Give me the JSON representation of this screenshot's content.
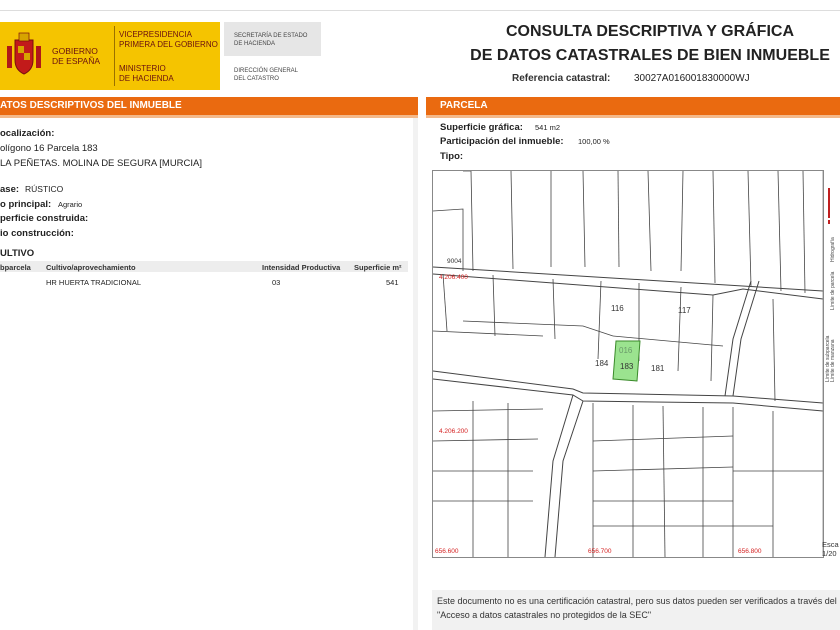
{
  "header": {
    "gov_line1": "GOBIERNO",
    "gov_line2": "DE ESPAÑA",
    "vice_line1": "VICEPRESIDENCIA",
    "vice_line2": "PRIMERA DEL GOBIERNO",
    "min_line1": "MINISTERIO",
    "min_line2": "DE HACIENDA",
    "sec_line1": "SECRETARÍA DE ESTADO",
    "sec_line2": "DE HACIENDA",
    "dir_line1": "DIRECCIÓN GENERAL",
    "dir_line2": "DEL CATASTRO",
    "title_line1": "CONSULTA DESCRIPTIVA Y GRÁFICA",
    "title_line2": "DE DATOS CATASTRALES DE BIEN INMUEBLE",
    "ref_label": "Referencia catastral:",
    "ref_value": "30027A016001830000WJ"
  },
  "left": {
    "bar_title": "ATOS DESCRIPTIVOS DEL INMUEBLE",
    "localizacion_label": "ocalización:",
    "localizacion_line1": "olígono 16 Parcela 183",
    "localizacion_line2": "LA PEÑETAS. MOLINA DE SEGURA [MURCIA]",
    "clase_label": "ase:",
    "clase_value": "RÚSTICO",
    "uso_label": "o principal:",
    "uso_value": "Agrario",
    "sup_label": "perficie construida:",
    "anio_label": "io construcción:",
    "cultivo_title": "ULTIVO",
    "cultivo_headers": [
      "bparcela",
      "Cultivo/aprovechamiento",
      "Intensidad Productiva",
      "Superficie m²"
    ],
    "cultivo_rows": [
      [
        "",
        "HR HUERTA TRADICIONAL",
        "03",
        "541"
      ]
    ]
  },
  "right": {
    "bar_title": "PARCELA",
    "sup_label": "Superficie gráfica:",
    "sup_value": "541 m2",
    "part_label": "Participación del inmueble:",
    "part_value": "100,00 %",
    "tipo_label": "Tipo:",
    "map_labels": {
      "p116": "116",
      "p117": "117",
      "p184": "184",
      "p016": "016",
      "p183": "183",
      "p181": "181",
      "coord_left_top": "4.206.400",
      "coord_left_mid": "4.206.200",
      "coord_bottom1": "656.600",
      "coord_bottom2": "656.700",
      "coord_bottom3": "656.800",
      "top_left_code": "9004"
    },
    "legend_items": [
      "Hidrografía",
      "Límite de parcela",
      "Límite de manzana",
      "Límite de subparcela"
    ],
    "scale_label": "Esca",
    "scale_value": "1/20",
    "note": "Este documento no es una certificación catastral, pero sus datos pueden ser verificados a través del \"Acceso a datos catastrales no protegidos de la SEC\""
  },
  "colors": {
    "orange": "#ea6a10",
    "gov_yellow": "#f5c400",
    "parcel_green": "#9be38f",
    "coord_red": "#d42020"
  }
}
